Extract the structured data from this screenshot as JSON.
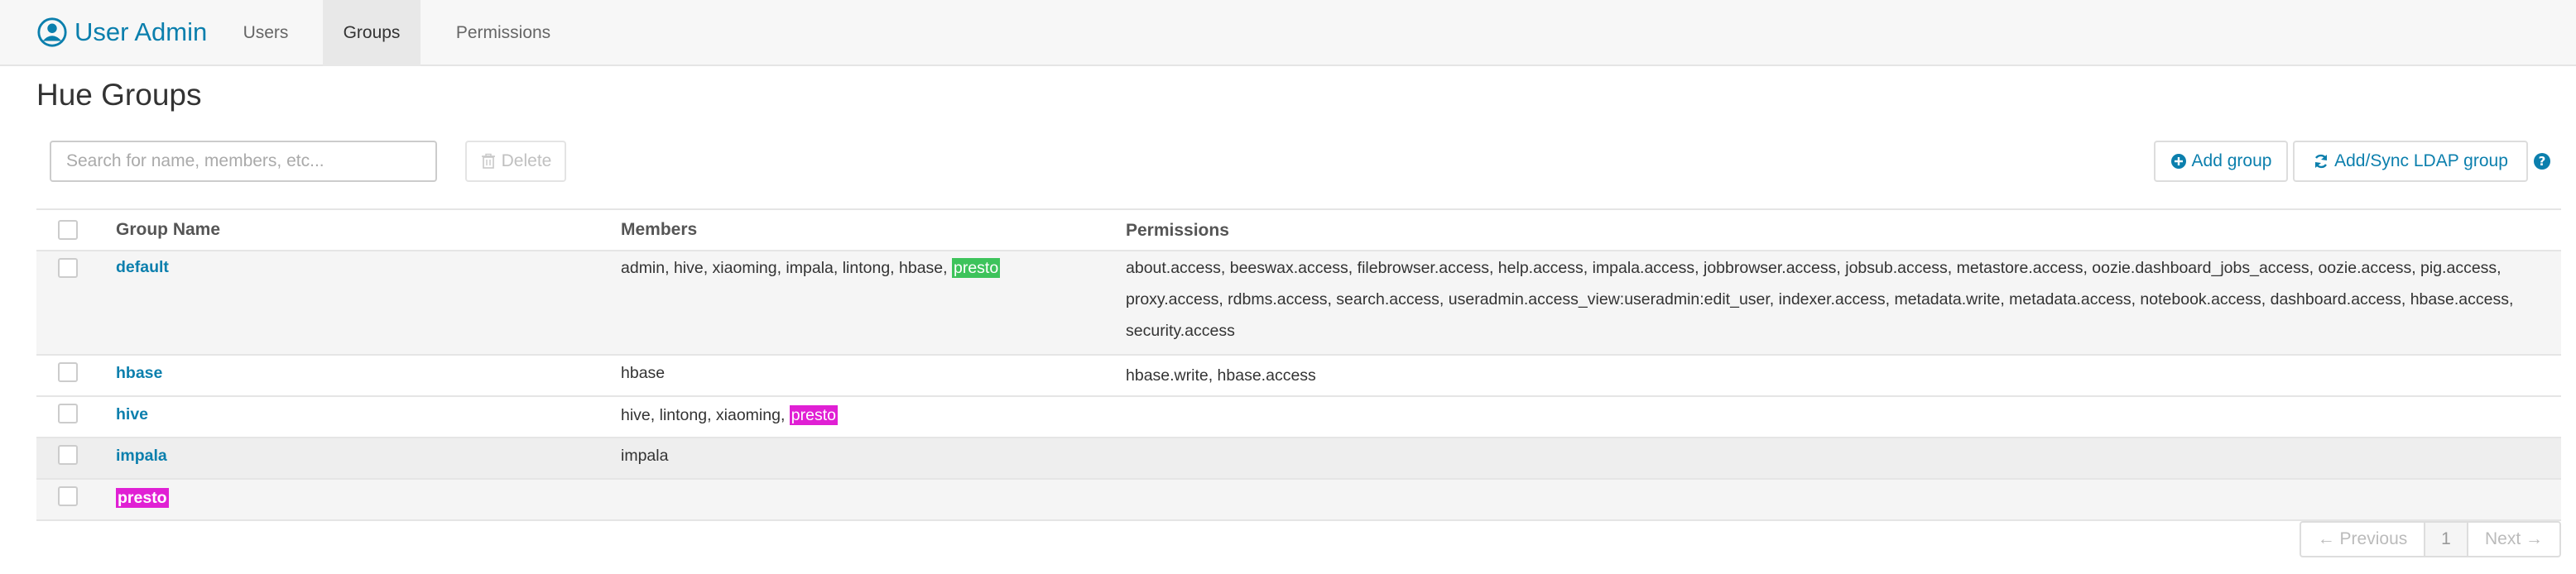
{
  "app": {
    "title": "User Admin",
    "icon": "user-circle-icon",
    "accent": "#0b7fad"
  },
  "nav": {
    "tabs": [
      {
        "label": "Users",
        "active": false
      },
      {
        "label": "Groups",
        "active": true
      },
      {
        "label": "Permissions",
        "active": false
      }
    ]
  },
  "page": {
    "title": "Hue Groups"
  },
  "toolbar": {
    "search_placeholder": "Search for name, members, etc...",
    "search_value": "",
    "delete_label": "Delete",
    "delete_icon": "trash-icon",
    "add_group_label": "Add group",
    "add_group_icon": "plus-circle-icon",
    "ldap_label": "Add/Sync LDAP group",
    "ldap_icon": "refresh-icon",
    "help_icon": "question-circle-icon"
  },
  "table": {
    "headers": {
      "name": "Group Name",
      "members": "Members",
      "permissions": "Permissions"
    },
    "rows": [
      {
        "name": "default",
        "members": "admin, hive, xiaoming, impala, lintong, hbase, ",
        "member_tag": "presto",
        "member_tag_color": "#3dc35b",
        "permissions": "about.access, beeswax.access, filebrowser.access, help.access, impala.access, jobbrowser.access, jobsub.access, metastore.access, oozie.dashboard_jobs_access, oozie.access, pig.access, proxy.access, rdbms.access, search.access, useradmin.access_view:useradmin:edit_user, indexer.access, metadata.write, metadata.access, notebook.access, dashboard.access, hbase.access, security.access"
      },
      {
        "name": "hbase",
        "members": "hbase",
        "member_tag": "",
        "permissions": "hbase.write, hbase.access"
      },
      {
        "name": "hive",
        "members": "hive, lintong, xiaoming, ",
        "member_tag": "presto",
        "member_tag_color": "#e020d4",
        "permissions": ""
      },
      {
        "name": "impala",
        "members": "impala",
        "member_tag": "",
        "permissions": ""
      },
      {
        "name": "presto",
        "name_highlight_color": "#e020d4",
        "members": "",
        "member_tag": "",
        "permissions": ""
      }
    ]
  },
  "pagination": {
    "previous": "← Previous",
    "page": "1",
    "next": "Next →"
  }
}
